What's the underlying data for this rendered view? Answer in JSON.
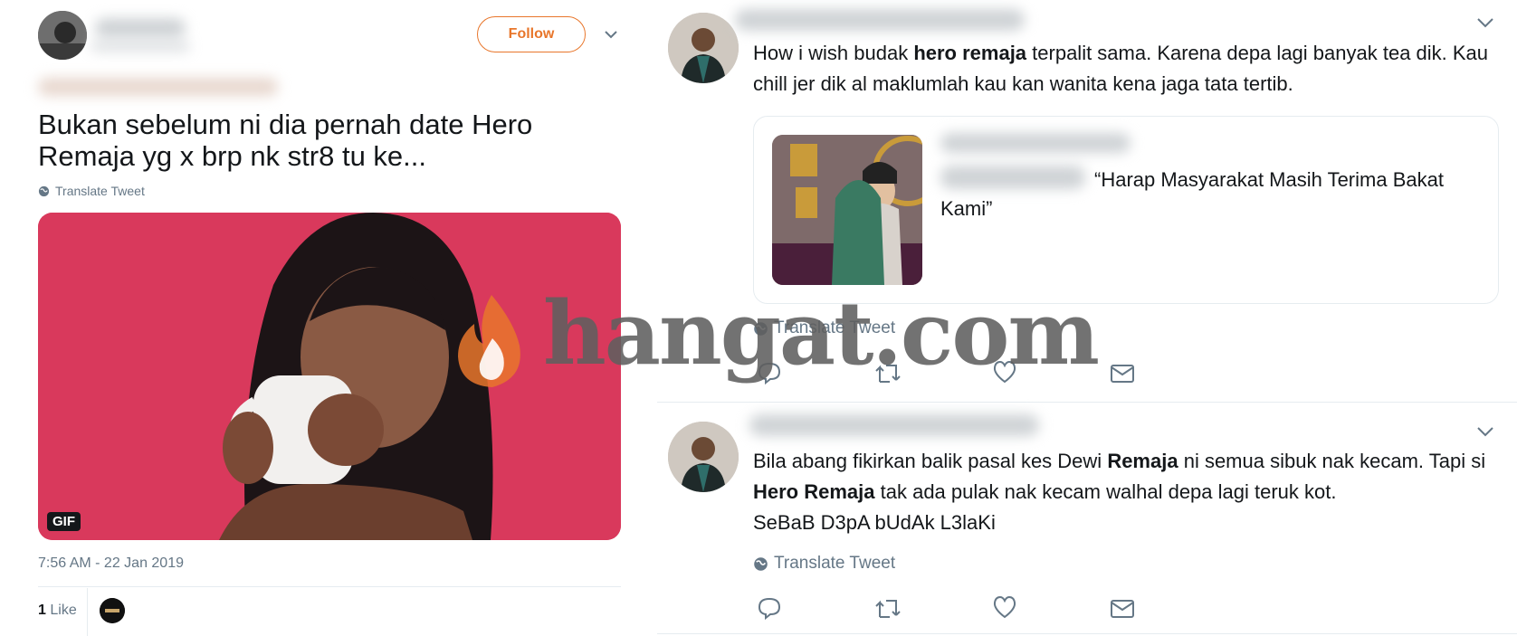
{
  "left_tweet": {
    "follow_label": "Follow",
    "text": "Bukan sebelum ni dia pernah date Hero Remaja yg x brp nk str8 tu ke...",
    "translate_label": "Translate Tweet",
    "media_badge": "GIF",
    "timestamp": "7:56 AM - 22 Jan 2019",
    "likes_count": "1",
    "likes_label": "Like"
  },
  "reply_1": {
    "text_parts": [
      "How i wish budak ",
      "hero remaja",
      " terpalit sama. Karena depa lagi banyak tea dik. Kau chill jer dik al maklumlah kau kan wanita kena jaga tata tertib."
    ],
    "quote_text": "“Harap Masyarakat Masih Terima Bakat Kami”",
    "translate_label": "Translate Tweet"
  },
  "reply_2": {
    "text_parts": [
      "Bila abang fikirkan balik pasal kes Dewi ",
      "Remaja",
      " ni semua sibuk nak kecam. Tapi si ",
      "Hero Remaja",
      " tak ada pulak nak kecam walhal depa lagi teruk kot."
    ],
    "text_line_3": "SeBaB D3pA bUdAk L3laKi",
    "translate_label": "Translate Tweet"
  },
  "watermark": {
    "text": "hangat.com"
  },
  "colors": {
    "accent": "#e8762b",
    "secondary_text": "#657786",
    "media_bg": "#d9395c"
  },
  "icons": [
    "chevron-down-icon",
    "globe-icon",
    "reply-icon",
    "retweet-icon",
    "like-icon",
    "dm-icon"
  ]
}
